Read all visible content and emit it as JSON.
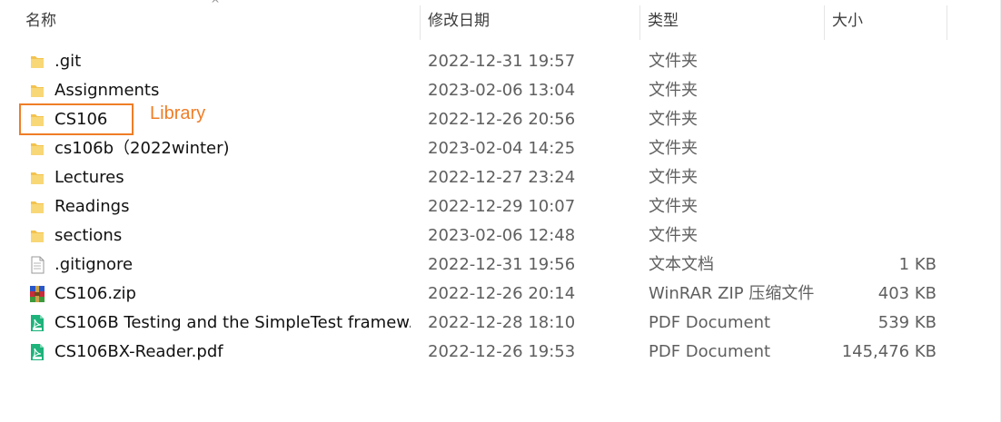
{
  "columns": {
    "name": "名称",
    "date": "修改日期",
    "type": "类型",
    "size": "大小"
  },
  "files": [
    {
      "name": ".git",
      "date": "2022-12-31 19:57",
      "type": "文件夹",
      "size": "",
      "icon": "folder-icon"
    },
    {
      "name": "Assignments",
      "date": "2023-02-06 13:04",
      "type": "文件夹",
      "size": "",
      "icon": "folder-icon"
    },
    {
      "name": "CS106",
      "date": "2022-12-26 20:56",
      "type": "文件夹",
      "size": "",
      "icon": "folder-icon"
    },
    {
      "name": "cs106b（2022winter)",
      "date": "2023-02-04 14:25",
      "type": "文件夹",
      "size": "",
      "icon": "folder-icon"
    },
    {
      "name": "Lectures",
      "date": "2022-12-27 23:24",
      "type": "文件夹",
      "size": "",
      "icon": "folder-icon"
    },
    {
      "name": "Readings",
      "date": "2022-12-29 10:07",
      "type": "文件夹",
      "size": "",
      "icon": "folder-icon"
    },
    {
      "name": "sections",
      "date": "2023-02-06 12:48",
      "type": "文件夹",
      "size": "",
      "icon": "folder-icon"
    },
    {
      "name": ".gitignore",
      "date": "2022-12-31 19:56",
      "type": "文本文档",
      "size": "1 KB",
      "icon": "text-file-icon"
    },
    {
      "name": "CS106.zip",
      "date": "2022-12-26 20:14",
      "type": "WinRAR ZIP 压缩文件",
      "size": "403 KB",
      "icon": "winrar-icon"
    },
    {
      "name": "CS106B Testing and the SimpleTest framew...",
      "date": "2022-12-28 18:10",
      "type": "PDF Document",
      "size": "539 KB",
      "icon": "pdf-icon"
    },
    {
      "name": "CS106BX-Reader.pdf",
      "date": "2022-12-26 19:53",
      "type": "PDF Document",
      "size": "145,476 KB",
      "icon": "pdf-icon"
    }
  ],
  "annotation": {
    "label": "Library",
    "color": "#ef7d26"
  },
  "colors": {
    "folder": "#f3c34e",
    "pdf": "#1db37a",
    "winrar_stack": [
      "#2a57c7",
      "#c92b3b",
      "#3c9a3c"
    ]
  }
}
